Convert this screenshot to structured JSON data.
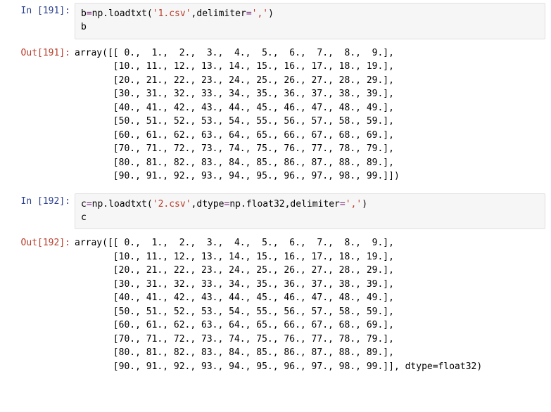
{
  "cells": [
    {
      "exec": 191,
      "in_prefix": "In  [",
      "out_prefix": "Out[",
      "suffix": "]:",
      "code_html": "b<span class='op'>=</span>np.loadtxt(<span class='str'>'1.csv'</span>,delimiter<span class='op'>=</span><span class='str'>','</span>)\nb",
      "output": "array([[ 0.,  1.,  2.,  3.,  4.,  5.,  6.,  7.,  8.,  9.],\n       [10., 11., 12., 13., 14., 15., 16., 17., 18., 19.],\n       [20., 21., 22., 23., 24., 25., 26., 27., 28., 29.],\n       [30., 31., 32., 33., 34., 35., 36., 37., 38., 39.],\n       [40., 41., 42., 43., 44., 45., 46., 47., 48., 49.],\n       [50., 51., 52., 53., 54., 55., 56., 57., 58., 59.],\n       [60., 61., 62., 63., 64., 65., 66., 67., 68., 69.],\n       [70., 71., 72., 73., 74., 75., 76., 77., 78., 79.],\n       [80., 81., 82., 83., 84., 85., 86., 87., 88., 89.],\n       [90., 91., 92., 93., 94., 95., 96., 97., 98., 99.]])"
    },
    {
      "exec": 192,
      "in_prefix": "In  [",
      "out_prefix": "Out[",
      "suffix": "]:",
      "code_html": "c<span class='op'>=</span>np.loadtxt(<span class='str'>'2.csv'</span>,dtype<span class='op'>=</span>np.float32,delimiter<span class='op'>=</span><span class='str'>','</span>)\nc",
      "output": "array([[ 0.,  1.,  2.,  3.,  4.,  5.,  6.,  7.,  8.,  9.],\n       [10., 11., 12., 13., 14., 15., 16., 17., 18., 19.],\n       [20., 21., 22., 23., 24., 25., 26., 27., 28., 29.],\n       [30., 31., 32., 33., 34., 35., 36., 37., 38., 39.],\n       [40., 41., 42., 43., 44., 45., 46., 47., 48., 49.],\n       [50., 51., 52., 53., 54., 55., 56., 57., 58., 59.],\n       [60., 61., 62., 63., 64., 65., 66., 67., 68., 69.],\n       [70., 71., 72., 73., 74., 75., 76., 77., 78., 79.],\n       [80., 81., 82., 83., 84., 85., 86., 87., 88., 89.],\n       [90., 91., 92., 93., 94., 95., 96., 97., 98., 99.]], dtype=float32)"
    }
  ]
}
